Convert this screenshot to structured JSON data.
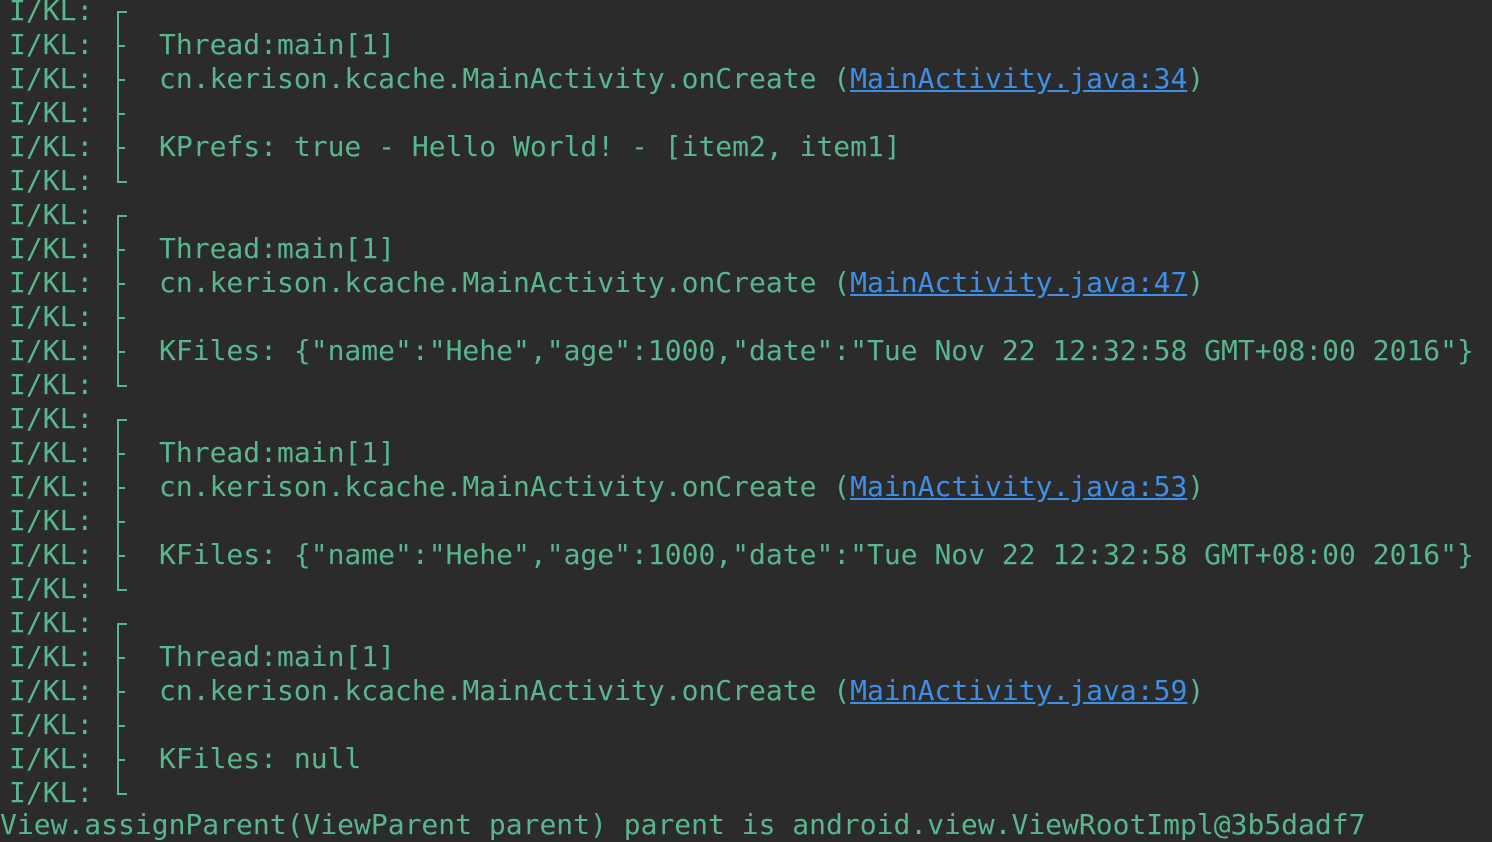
{
  "tag": "I/KL:",
  "blocks": [
    {
      "thread": "Thread:main[1]",
      "method": "cn.kerison.kcache.MainActivity.onCreate",
      "source": "MainActivity.java:34",
      "message": "KPrefs: true - Hello World! - [item2, item1]"
    },
    {
      "thread": "Thread:main[1]",
      "method": "cn.kerison.kcache.MainActivity.onCreate",
      "source": "MainActivity.java:47",
      "message": "KFiles: {\"name\":\"Hehe\",\"age\":1000,\"date\":\"Tue Nov 22 12:32:58 GMT+08:00 2016\"}"
    },
    {
      "thread": "Thread:main[1]",
      "method": "cn.kerison.kcache.MainActivity.onCreate",
      "source": "MainActivity.java:53",
      "message": "KFiles: {\"name\":\"Hehe\",\"age\":1000,\"date\":\"Tue Nov 22 12:32:58 GMT+08:00 2016\"}"
    },
    {
      "thread": "Thread:main[1]",
      "method": "cn.kerison.kcache.MainActivity.onCreate",
      "source": "MainActivity.java:59",
      "message": "KFiles: null"
    }
  ],
  "cutoff_line": "View.assignParent(ViewParent parent) parent is android.view.ViewRootImpl@3b5dadf7",
  "colors": {
    "background": "#2b2b2b",
    "text": "#59b68f",
    "link": "#3f8fe6"
  }
}
